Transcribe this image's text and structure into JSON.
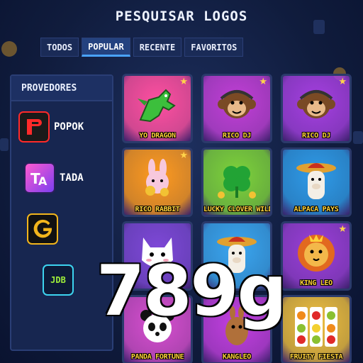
{
  "header": {
    "title": "PESQUISAR LOGOS"
  },
  "tabs": [
    {
      "label": "TODOS"
    },
    {
      "label": "POPULAR"
    },
    {
      "label": "RECENTE"
    },
    {
      "label": "FAVORITOS"
    }
  ],
  "active_tab": "POPULAR",
  "sidebar": {
    "title": "PROVEDORES",
    "providers": [
      {
        "name": "POPOK",
        "icon": "popok-logo"
      },
      {
        "name": "TADA",
        "icon": "tada-logo"
      },
      {
        "name": "",
        "icon": "g-logo"
      },
      {
        "name": "",
        "icon": "jdb-logo",
        "logo_text": "JDB"
      }
    ]
  },
  "games": [
    {
      "name": "YO DRAGON",
      "favorite": true,
      "icon": "dragon-icon",
      "bg": "#ff4fa0"
    },
    {
      "name": "RICO DJ",
      "favorite": true,
      "icon": "monkey-icon",
      "bg": "#c13fd6"
    },
    {
      "name": "RICO DJ",
      "favorite": true,
      "icon": "monkey-icon",
      "bg": "#a53fe0"
    },
    {
      "name": "RICO RABBIT",
      "favorite": true,
      "icon": "rabbit-icon",
      "bg": "#ff9a1f"
    },
    {
      "name": "LUCKY CLOVER WILD",
      "favorite": false,
      "icon": "clover-icon",
      "bg": "#7ed33a"
    },
    {
      "name": "ALPACA PAYS",
      "favorite": false,
      "icon": "alpaca-icon",
      "bg": "#2f9be8"
    },
    {
      "name": "",
      "favorite": false,
      "icon": "cat-icon",
      "bg": "#7f48d8"
    },
    {
      "name": "",
      "favorite": false,
      "icon": "alpaca-icon",
      "bg": "#3aa6f0"
    },
    {
      "name": "KING LEO",
      "favorite": true,
      "icon": "lion-icon",
      "bg": "#9b3fd8"
    },
    {
      "name": "PANDA FORTUNE",
      "favorite": false,
      "icon": "panda-icon",
      "bg": "#d84fd0"
    },
    {
      "name": "KANGLEO",
      "favorite": false,
      "icon": "kangaroo-icon",
      "bg": "#c23fe0"
    },
    {
      "name": "FRUITY FIESTA",
      "favorite": false,
      "icon": "fruit-icon",
      "bg": "#f0c040"
    }
  ],
  "watermark": "789g"
}
